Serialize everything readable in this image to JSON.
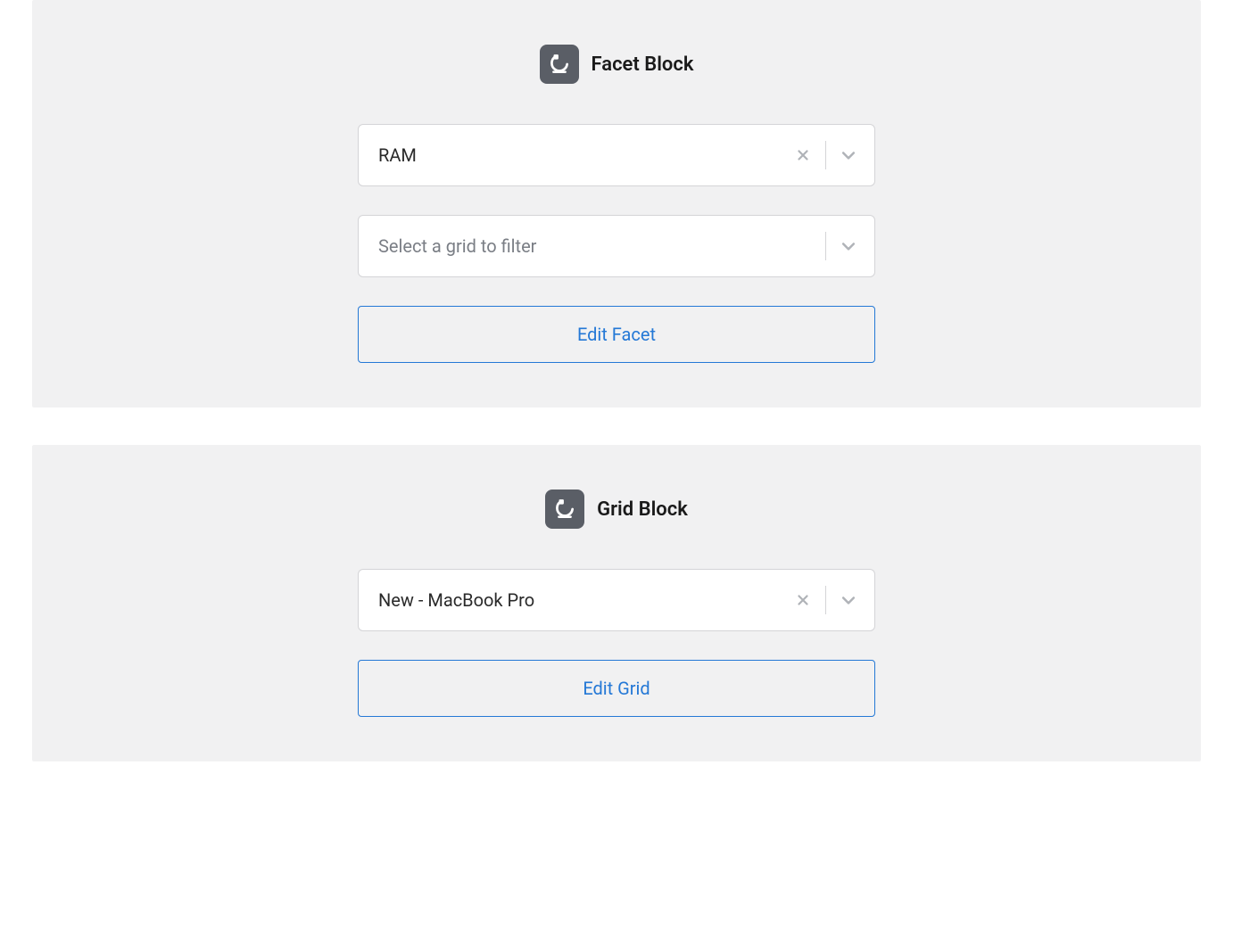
{
  "facet_block": {
    "title": "Facet Block",
    "facet_select": {
      "value": "RAM"
    },
    "grid_select": {
      "placeholder": "Select a grid to filter"
    },
    "edit_button_label": "Edit Facet"
  },
  "grid_block": {
    "title": "Grid Block",
    "grid_select": {
      "value": "New - MacBook Pro"
    },
    "edit_button_label": "Edit Grid"
  }
}
